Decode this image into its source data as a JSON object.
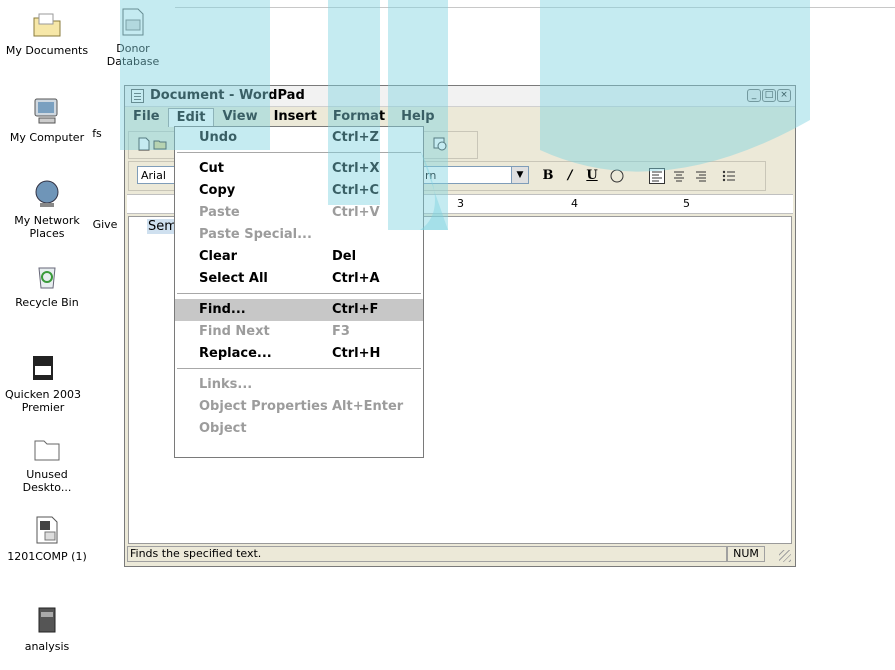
{
  "desktop_icons": [
    {
      "label": "My Documents",
      "icon": "my-documents-icon"
    },
    {
      "label": "Donor Database",
      "icon": "document-icon"
    },
    {
      "label": "My Computer",
      "icon": "my-computer-icon"
    },
    {
      "label": "fs",
      "icon": "folder-icon"
    },
    {
      "label": "My Network Places",
      "icon": "network-icon"
    },
    {
      "label": "Give",
      "icon": "document-icon"
    },
    {
      "label": "Recycle Bin",
      "icon": "recycle-bin-icon"
    },
    {
      "label": "Quicken 2003 Premier",
      "icon": "quicken-icon"
    },
    {
      "label": "Unused Deskto...",
      "icon": "folder-icon"
    },
    {
      "label": "1201COMP (1)",
      "icon": "spreadsheet-icon"
    },
    {
      "label": "analysis",
      "icon": "cabinet-icon"
    }
  ],
  "window": {
    "title": "Document - WordPad",
    "menu": [
      "File",
      "Edit",
      "View",
      "Insert",
      "Format",
      "Help"
    ],
    "font_name": "Arial",
    "script_select": "rn",
    "format_buttons": [
      "B",
      "/",
      "U"
    ],
    "ruler_numbers": [
      "3",
      "4",
      "5"
    ],
    "document_text": "Sem",
    "status_text": "Finds the specified text.",
    "status_num": "NUM"
  },
  "edit_menu": {
    "groups": [
      [
        {
          "label": "Undo",
          "shortcut": "Ctrl+Z",
          "enabled": true
        }
      ],
      [
        {
          "label": "Cut",
          "shortcut": "Ctrl+X",
          "enabled": true
        },
        {
          "label": "Copy",
          "shortcut": "Ctrl+C",
          "enabled": true
        },
        {
          "label": "Paste",
          "shortcut": "Ctrl+V",
          "enabled": false
        },
        {
          "label": "Paste Special...",
          "shortcut": "",
          "enabled": false
        },
        {
          "label": "Clear",
          "shortcut": "Del",
          "enabled": true
        },
        {
          "label": "Select All",
          "shortcut": "Ctrl+A",
          "enabled": true
        }
      ],
      [
        {
          "label": "Find...",
          "shortcut": "Ctrl+F",
          "enabled": true,
          "highlighted": true
        },
        {
          "label": "Find Next",
          "shortcut": "F3",
          "enabled": false
        },
        {
          "label": "Replace...",
          "shortcut": "Ctrl+H",
          "enabled": true
        }
      ],
      [
        {
          "label": "Links...",
          "shortcut": "",
          "enabled": false
        },
        {
          "label": "Object Properties",
          "shortcut": "Alt+Enter",
          "enabled": false
        },
        {
          "label": "Object",
          "shortcut": "",
          "enabled": false
        }
      ]
    ]
  },
  "colors": {
    "watermark": "#7fd3e0",
    "highlight": "#c7c7c7",
    "disabled": "#9c9c9c"
  }
}
